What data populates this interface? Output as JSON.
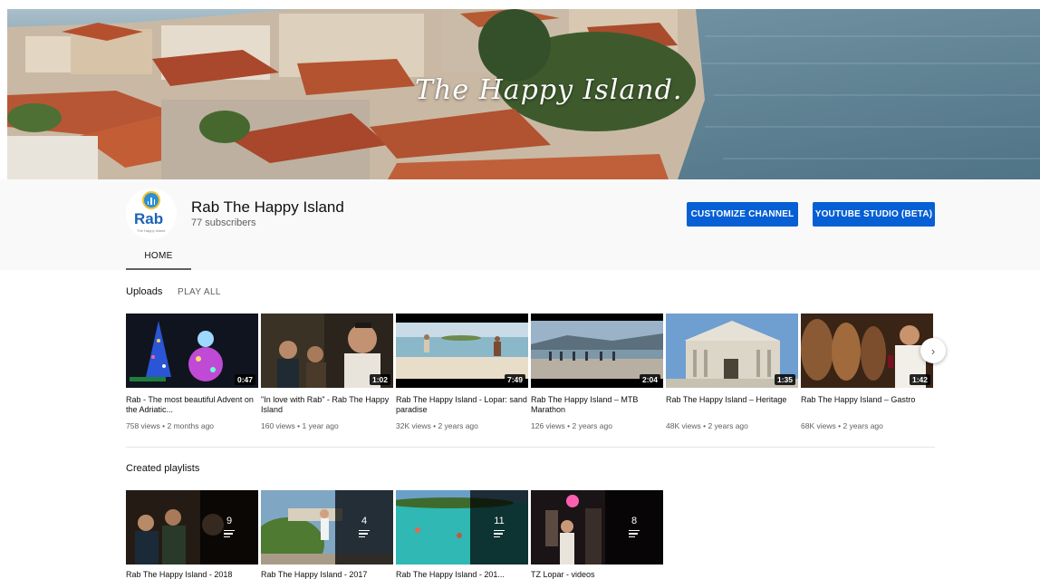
{
  "banner": {
    "title": "The Happy Island."
  },
  "channel": {
    "name": "Rab The Happy Island",
    "subscribers": "77 subscribers",
    "avatar_text": "Rab",
    "avatar_tagline": "The Happy Island"
  },
  "buttons": {
    "customize": "CUSTOMIZE CHANNEL",
    "studio": "YOUTUBE STUDIO (BETA)"
  },
  "tabs": [
    {
      "label": "HOME",
      "active": true
    }
  ],
  "uploads": {
    "title": "Uploads",
    "play_all": "PLAY ALL",
    "next_icon": "chevron-right-icon",
    "videos": [
      {
        "title": "Rab - The most beautiful Advent on the Adriatic...",
        "duration": "0:47",
        "views": "758 views",
        "age": "2 months ago"
      },
      {
        "title": "\"In love with Rab\" - Rab The Happy Island",
        "duration": "1:02",
        "views": "160 views",
        "age": "1 year ago"
      },
      {
        "title": "Rab The Happy Island - Lopar: sand paradise",
        "duration": "7:49",
        "views": "32K views",
        "age": "2 years ago"
      },
      {
        "title": "Rab The Happy Island – MTB Marathon",
        "duration": "2:04",
        "views": "126 views",
        "age": "2 years ago"
      },
      {
        "title": "Rab The Happy Island – Heritage",
        "duration": "1:35",
        "views": "48K views",
        "age": "2 years ago"
      },
      {
        "title": "Rab The Happy Island – Gastro",
        "duration": "1:42",
        "views": "68K views",
        "age": "2 years ago"
      }
    ]
  },
  "playlists": {
    "title": "Created playlists",
    "items": [
      {
        "title": "Rab The Happy Island - 2018",
        "count": "9"
      },
      {
        "title": "Rab The Happy Island - 2017",
        "count": "4"
      },
      {
        "title": "Rab The Happy Island - 201...",
        "count": "11"
      },
      {
        "title": "TZ Lopar - videos",
        "count": "8"
      }
    ]
  },
  "colors": {
    "accent": "#065fd4",
    "header_bg": "#f9f9f9"
  }
}
